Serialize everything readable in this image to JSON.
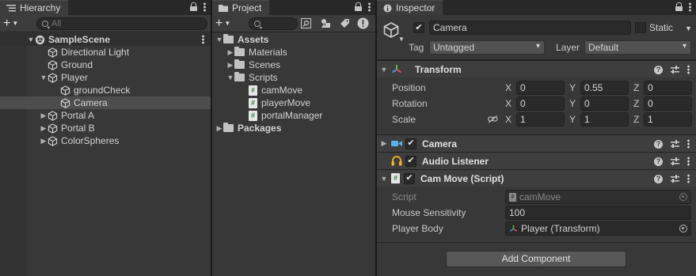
{
  "hierarchy": {
    "tab_title": "Hierarchy",
    "search_placeholder": "All",
    "items": [
      {
        "label": "SampleScene",
        "kind": "scene"
      },
      {
        "label": "Directional Light"
      },
      {
        "label": "Ground"
      },
      {
        "label": "Player"
      },
      {
        "label": "groundCheck"
      },
      {
        "label": "Camera"
      },
      {
        "label": "Portal A"
      },
      {
        "label": "Portal B"
      },
      {
        "label": "ColorSpheres"
      }
    ]
  },
  "project": {
    "tab_title": "Project",
    "tree": [
      {
        "label": "Assets",
        "kind": "folder-root"
      },
      {
        "label": "Materials",
        "kind": "folder"
      },
      {
        "label": "Scenes",
        "kind": "folder"
      },
      {
        "label": "Scripts",
        "kind": "folder"
      },
      {
        "label": "camMove",
        "kind": "script"
      },
      {
        "label": "playerMove",
        "kind": "script"
      },
      {
        "label": "portalManager",
        "kind": "script"
      },
      {
        "label": "Packages",
        "kind": "folder-root"
      }
    ]
  },
  "inspector": {
    "tab_title": "Inspector",
    "object_name": "Camera",
    "static_label": "Static",
    "tag_label": "Tag",
    "tag_value": "Untagged",
    "layer_label": "Layer",
    "layer_value": "Default",
    "transform": {
      "title": "Transform",
      "position_label": "Position",
      "rotation_label": "Rotation",
      "scale_label": "Scale",
      "axis_x": "X",
      "axis_y": "Y",
      "axis_z": "Z",
      "position": {
        "x": "0",
        "y": "0.55",
        "z": "0"
      },
      "rotation": {
        "x": "0",
        "y": "0",
        "z": "0"
      },
      "scale": {
        "x": "1",
        "y": "1",
        "z": "1"
      }
    },
    "camera_component": "Camera",
    "audio_listener": "Audio Listener",
    "script_component": {
      "title": "Cam Move (Script)",
      "script_label": "Script",
      "script_value": "camMove",
      "sensitivity_label": "Mouse Sensitivity",
      "sensitivity_value": "100",
      "player_body_label": "Player Body",
      "player_body_value": "Player (Transform)"
    },
    "add_component_label": "Add Component"
  },
  "colors": {
    "panel_bg": "#383838",
    "selection": "#4d4d4d",
    "field_bg": "#2a2a2a"
  }
}
